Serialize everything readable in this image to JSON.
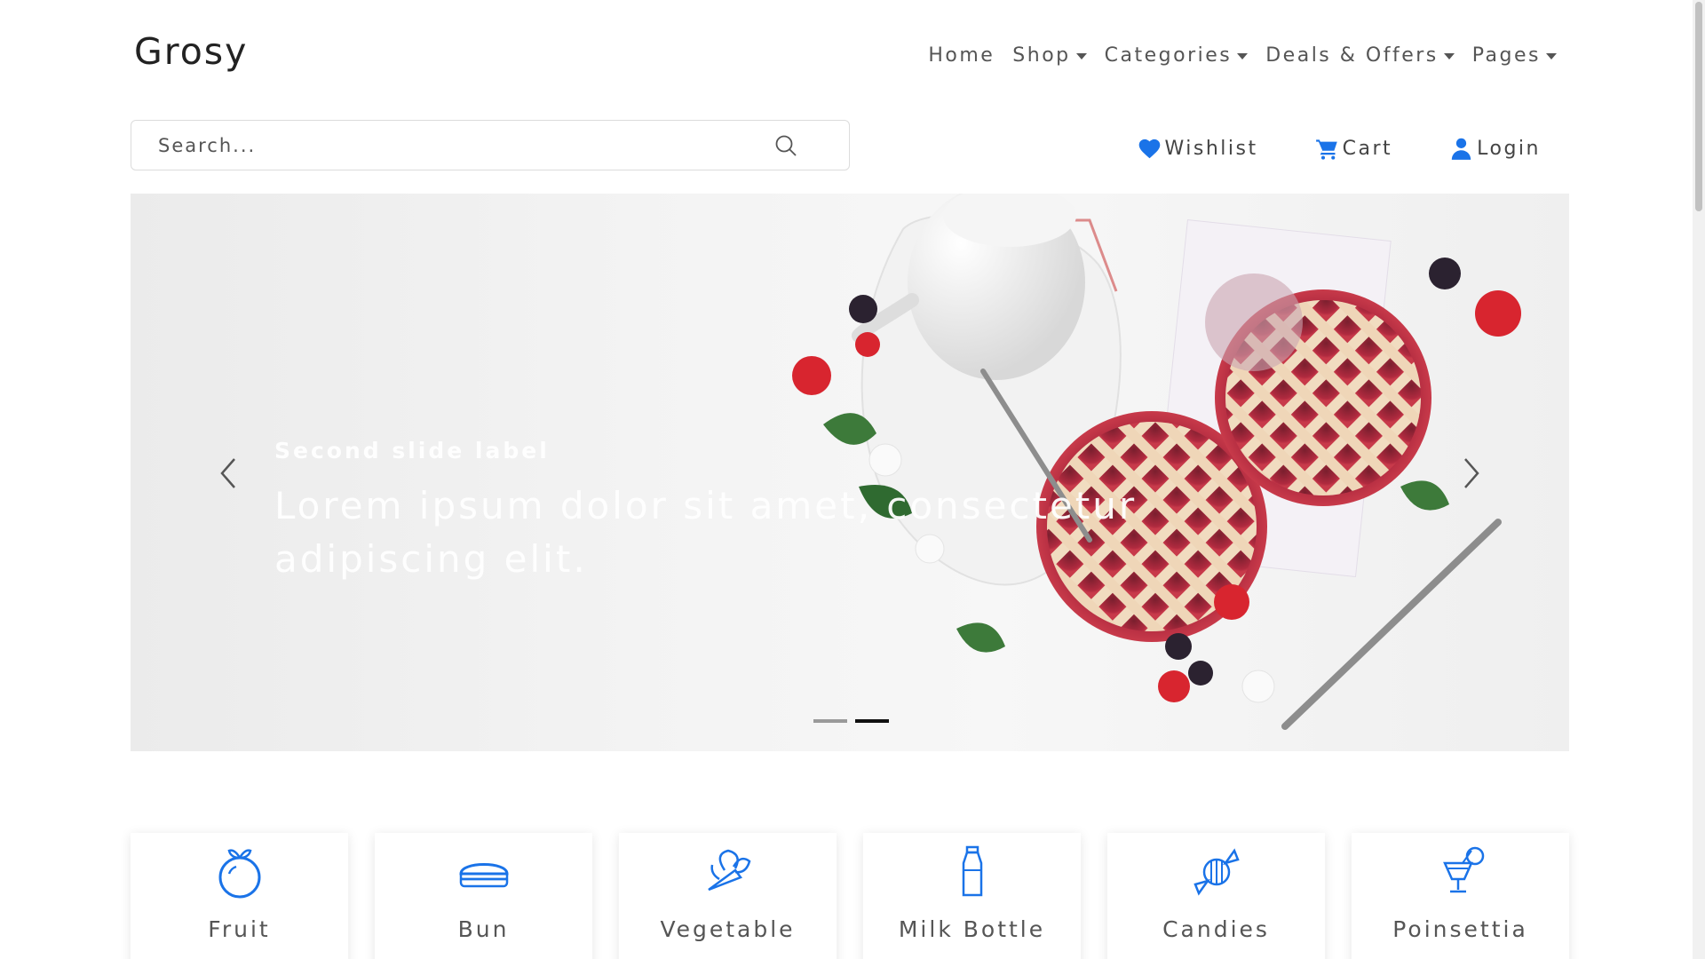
{
  "brand": "Grosy",
  "nav": {
    "items": [
      {
        "label": "Home",
        "dropdown": false
      },
      {
        "label": "Shop",
        "dropdown": true
      },
      {
        "label": "Categories",
        "dropdown": true
      },
      {
        "label": "Deals & Offers",
        "dropdown": true
      },
      {
        "label": "Pages",
        "dropdown": true
      }
    ]
  },
  "search": {
    "placeholder": "Search...",
    "value": "",
    "icon": "search-icon"
  },
  "actions": {
    "wishlist": {
      "label": "Wishlist",
      "icon": "heart-icon"
    },
    "cart": {
      "label": "Cart",
      "icon": "cart-icon"
    },
    "login": {
      "label": "Login",
      "icon": "user-icon"
    }
  },
  "carousel": {
    "slide_label": "Second slide label",
    "slide_text": "Lorem ipsum dolor sit amet, consectetur adipiscing elit.",
    "slide_count": 2,
    "active_index": 1,
    "prev_icon": "chevron-left-icon",
    "next_icon": "chevron-right-icon"
  },
  "categories": [
    {
      "name": "Fruit",
      "icon": "fruit-icon"
    },
    {
      "name": "Bun",
      "icon": "bun-icon"
    },
    {
      "name": "Vegetable",
      "icon": "vegetable-icon"
    },
    {
      "name": "Milk Bottle",
      "icon": "milk-bottle-icon"
    },
    {
      "name": "Candies",
      "icon": "candy-icon"
    },
    {
      "name": "Poinsettia",
      "icon": "drink-icon"
    }
  ],
  "colors": {
    "accent": "#1a73e8",
    "text": "#555555",
    "brand_text": "#222222"
  }
}
